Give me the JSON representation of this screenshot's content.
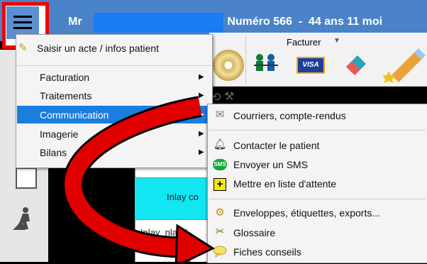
{
  "window": {
    "title_prefix": "Mr",
    "title_suffix": "- Numéro 566  -  44 ans 11 moi"
  },
  "toolbar": {
    "facturer_label": "Facturer",
    "facturer_arrow": "▼"
  },
  "main_menu": {
    "items": [
      {
        "label": "Saisir un acte / infos patient",
        "submenu": false
      },
      {
        "label": "Facturation",
        "submenu": true
      },
      {
        "label": "Traitements",
        "submenu": true
      },
      {
        "label": "Communication",
        "submenu": true,
        "highlighted": true
      },
      {
        "label": "Imagerie",
        "submenu": true
      },
      {
        "label": "Bilans",
        "submenu": true
      }
    ],
    "arrow_glyph": "▶"
  },
  "sub_menu": {
    "items": [
      {
        "label": "Courriers, compte-rendus",
        "icon": "envelope-icon"
      },
      {
        "label": "Contacter le patient",
        "icon": "bell-icon"
      },
      {
        "label": "Envoyer un SMS",
        "icon": "sms-icon"
      },
      {
        "label": "Mettre en liste d'attente",
        "icon": "plus-box-icon"
      },
      {
        "label": "Enveloppes, étiquettes, exports...",
        "icon": "drill-icon"
      },
      {
        "label": "Glossaire",
        "icon": "tools-icon"
      },
      {
        "label": "Fiches conseils",
        "icon": "speech-bubble-icon"
      }
    ],
    "sms_text": "SMS"
  },
  "background_grid": {
    "cells": [
      "Inlay co",
      "Inlay  nlay /",
      "outi"
    ]
  },
  "colors": {
    "titlebar": "#4b83c8",
    "redaction": "#1a7cf2",
    "highlight_frame": "#f20000",
    "selection": "#1a7de0",
    "cyan_cell": "#13e6f3",
    "arrow": "#e00000"
  }
}
